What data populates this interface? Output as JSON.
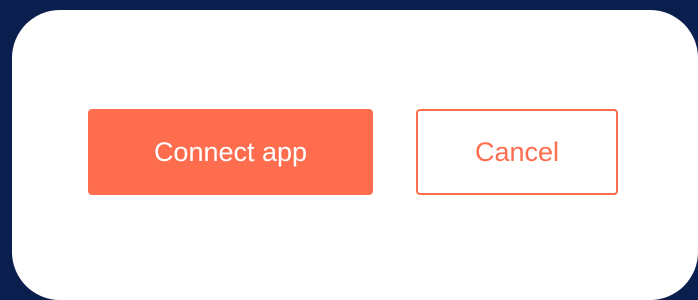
{
  "dialog": {
    "primary_button_label": "Connect app",
    "secondary_button_label": "Cancel"
  },
  "colors": {
    "background": "#0b1f4f",
    "dialog": "#ffffff",
    "accent": "#ff6d4f"
  }
}
